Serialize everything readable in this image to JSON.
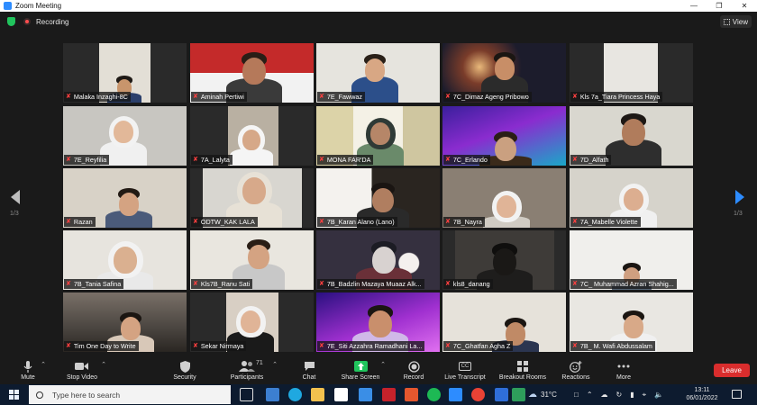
{
  "window": {
    "title": "Zoom Meeting"
  },
  "recording": {
    "label": "Recording"
  },
  "view_button": {
    "label": "View"
  },
  "pager": {
    "left": "1/3",
    "right": "1/3"
  },
  "participants": [
    {
      "name": "Malaka Inzaghi-8C"
    },
    {
      "name": "Aminah Pertiwi"
    },
    {
      "name": "7E_Fawwaz"
    },
    {
      "name": "7C_Dimaz Ageng Pribowo"
    },
    {
      "name": "Kls 7a_Tiara Princess Haya"
    },
    {
      "name": "7E_Reyfilia"
    },
    {
      "name": "7A_Lalyta"
    },
    {
      "name": "MONA FAR'DA"
    },
    {
      "name": "7C_Erlando"
    },
    {
      "name": "7D_Alfath"
    },
    {
      "name": "Razan"
    },
    {
      "name": "ODTW_KAK LALA"
    },
    {
      "name": "7B_Karan Alano (Lano)"
    },
    {
      "name": "7B_Nayra"
    },
    {
      "name": "7A_Mabelle Violette"
    },
    {
      "name": "7B_Tania Safina"
    },
    {
      "name": "Kls7B_Ranu Sati"
    },
    {
      "name": "7B_Badzlin Mazaya Muaaz Alk..."
    },
    {
      "name": "kls8_danang"
    },
    {
      "name": "7C_ Muhammad Azran Shahig..."
    },
    {
      "name": "Tim One Day to Write"
    },
    {
      "name": "Sekar Nirmaya"
    },
    {
      "name": "7E_Siti Azzahra Ramadhani La..."
    },
    {
      "name": "7C_Ghatfan Agha Z"
    },
    {
      "name": "7B_ M. Wafi Abdussalam"
    }
  ],
  "toolbar": {
    "mute": "Mute",
    "stop_video": "Stop Video",
    "security": "Security",
    "participants": "Participants",
    "participants_count": "71",
    "chat": "Chat",
    "share_screen": "Share Screen",
    "record": "Record",
    "live_transcript": "Live Transcript",
    "cc_badge": "CC",
    "breakout_rooms": "Breakout Rooms",
    "reactions": "Reactions",
    "more": "More",
    "leave": "Leave"
  },
  "taskbar": {
    "search_placeholder": "Type here to search",
    "weather": "31°C",
    "time": "13:11",
    "date": "06/01/2022"
  },
  "colors": {
    "accent_blue": "#2d8cff",
    "leave_red": "#d92d2d",
    "share_green": "#21c45d",
    "active_speaker": "#a8e043",
    "muted_red": "#ff4040"
  }
}
